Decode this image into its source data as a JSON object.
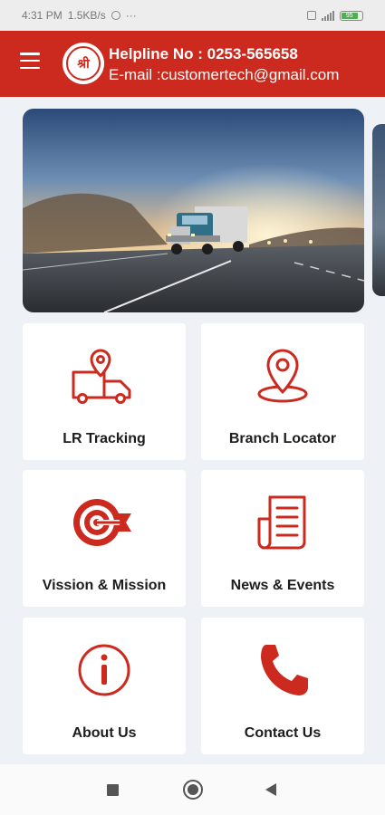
{
  "status_bar": {
    "time": "4:31 PM",
    "speed": "1.5KB/s",
    "dots": "···",
    "battery": "95"
  },
  "header": {
    "logo_text": "श्री",
    "helpline": "Helpline No : 0253-565658",
    "email": "E-mail :customertech@gmail.com"
  },
  "tiles": [
    {
      "label": "LR Tracking",
      "icon": "truck-location-icon"
    },
    {
      "label": "Branch Locator",
      "icon": "map-pin-icon"
    },
    {
      "label": "Vission & Mission",
      "icon": "target-icon"
    },
    {
      "label": "News & Events",
      "icon": "newspaper-icon"
    },
    {
      "label": "About Us",
      "icon": "info-icon"
    },
    {
      "label": "Contact Us",
      "icon": "phone-icon"
    }
  ],
  "colors": {
    "brand_red": "#cc2a1e",
    "background": "#eef1f6"
  }
}
